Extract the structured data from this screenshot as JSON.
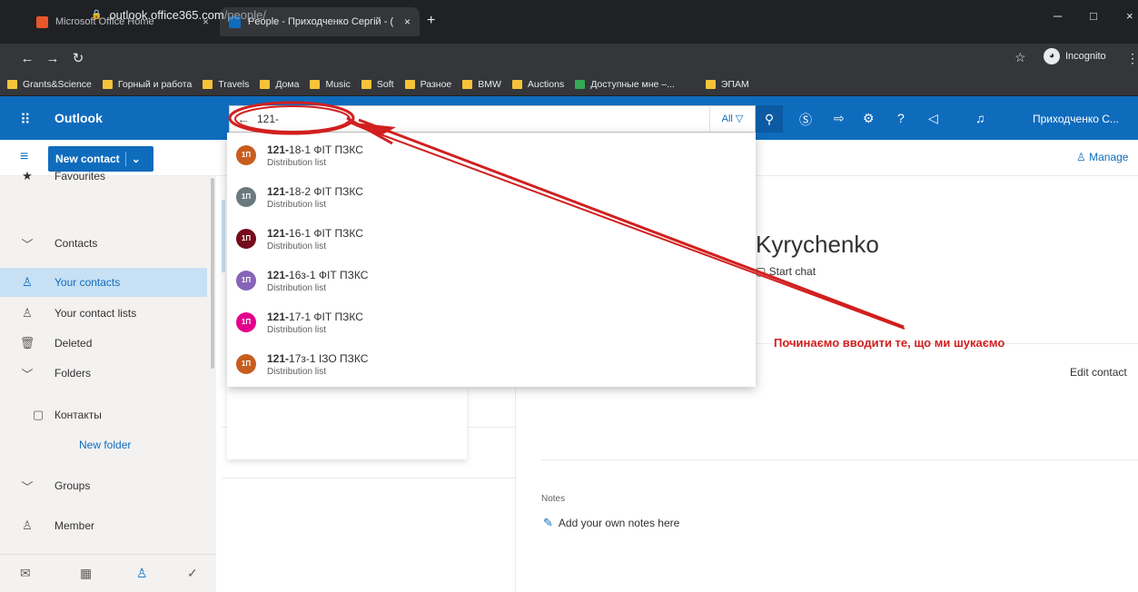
{
  "browser": {
    "tabs": [
      {
        "title": "Microsoft Office Home",
        "favicon_color": "#e8562a"
      },
      {
        "title": "People - Приходченко Сергій - ( ",
        "favicon_color": "#0f6cbd"
      }
    ],
    "new_tab_label": "+",
    "url_host": "outlook.office365.com",
    "url_path": "/people/",
    "incognito_label": "Incognito",
    "bookmarks": [
      "Grants&Science",
      "Горный и работа",
      "Travels",
      "Дома",
      "Music",
      "Soft",
      "Разное",
      "BMW",
      "Auctions",
      "Доступные мне –...",
      "ЭПАМ"
    ]
  },
  "outlook": {
    "brand": "Outlook",
    "search": {
      "query": "121-",
      "filter_label": "All"
    },
    "user_name": "Приходченко С...",
    "new_contact_label": "New contact",
    "manage_label": "Manage"
  },
  "leftnav": {
    "items": [
      {
        "label": "Favourites",
        "icon": "★"
      },
      {
        "label": "Contacts",
        "icon": "﹀"
      },
      {
        "label": "Your contacts",
        "icon": "♙"
      },
      {
        "label": "Your contact lists",
        "icon": "♙"
      },
      {
        "label": "Deleted",
        "icon": "🗑"
      },
      {
        "label": "Folders",
        "icon": "﹀"
      },
      {
        "label": "Контакты",
        "icon": "▢"
      },
      {
        "label": "New folder",
        "icon": ""
      },
      {
        "label": "Groups",
        "icon": "﹀"
      },
      {
        "label": "Member",
        "icon": "♙"
      }
    ]
  },
  "suggestions": [
    {
      "prefix": "121-",
      "rest": "18-1 ФІТ ПЗКС",
      "type": "Distribution list",
      "initials": "1П",
      "color": "#c75d1e"
    },
    {
      "prefix": "121-",
      "rest": "18-2 ФІТ ПЗКС",
      "type": "Distribution list",
      "initials": "1П",
      "color": "#69797e"
    },
    {
      "prefix": "121-",
      "rest": "16-1 ФІТ ПЗКС",
      "type": "Distribution list",
      "initials": "1П",
      "color": "#750b1c"
    },
    {
      "prefix": "121-",
      "rest": "16з-1 ФІТ ПЗКС",
      "type": "Distribution list",
      "initials": "1П",
      "color": "#8764b8"
    },
    {
      "prefix": "121-",
      "rest": "17-1 ФІТ ПЗКС",
      "type": "Distribution list",
      "initials": "1П",
      "color": "#e3008c"
    },
    {
      "prefix": "121-",
      "rest": "17з-1 ІЗО ПЗКС",
      "type": "Distribution list",
      "initials": "1П",
      "color": "#c75d1e"
    }
  ],
  "detail": {
    "name": "Kyrychenko",
    "start_chat": "Start chat",
    "edit_contact": "Edit contact",
    "notes_label": "Notes",
    "notes_add": "Add your own notes here"
  },
  "annotation": {
    "text": "Починаємо вводити те, що ми шукаємо",
    "color": "#d21f1f"
  }
}
